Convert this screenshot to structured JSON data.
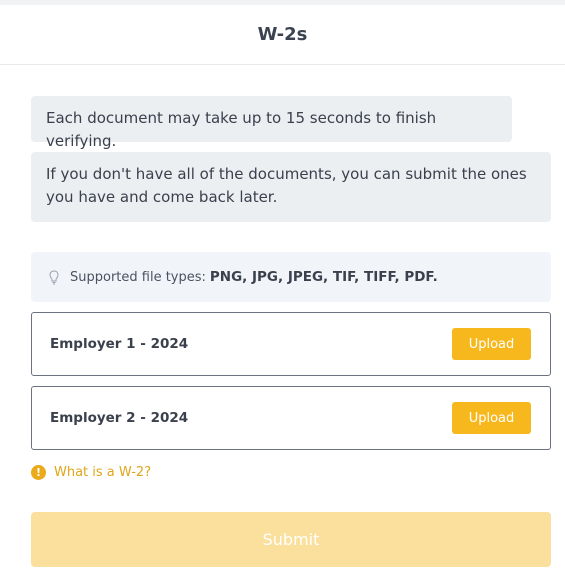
{
  "header": {
    "title": "W-2s"
  },
  "notes": [
    "Each document may take up to 15 seconds to finish verifying.",
    "If you don't have all of the documents, you can submit the ones you have and come back later."
  ],
  "file_types": {
    "label": "Supported file types:",
    "types": "PNG, JPG, JPEG, TIF, TIFF, PDF.",
    "icon": "lightbulb-icon"
  },
  "employers": [
    {
      "label": "Employer 1 - 2024",
      "button": "Upload"
    },
    {
      "label": "Employer 2 - 2024",
      "button": "Upload"
    }
  ],
  "help": {
    "icon": "info-icon",
    "glyph": "!",
    "label": "What is a W-2?"
  },
  "submit": {
    "label": "Submit",
    "state": "disabled"
  },
  "colors": {
    "accent": "#f7b81d",
    "accent_disabled": "#fbdf9c",
    "note_bg": "#eceff2",
    "info_bg": "#f1f5fa",
    "link": "#e0a61a"
  }
}
